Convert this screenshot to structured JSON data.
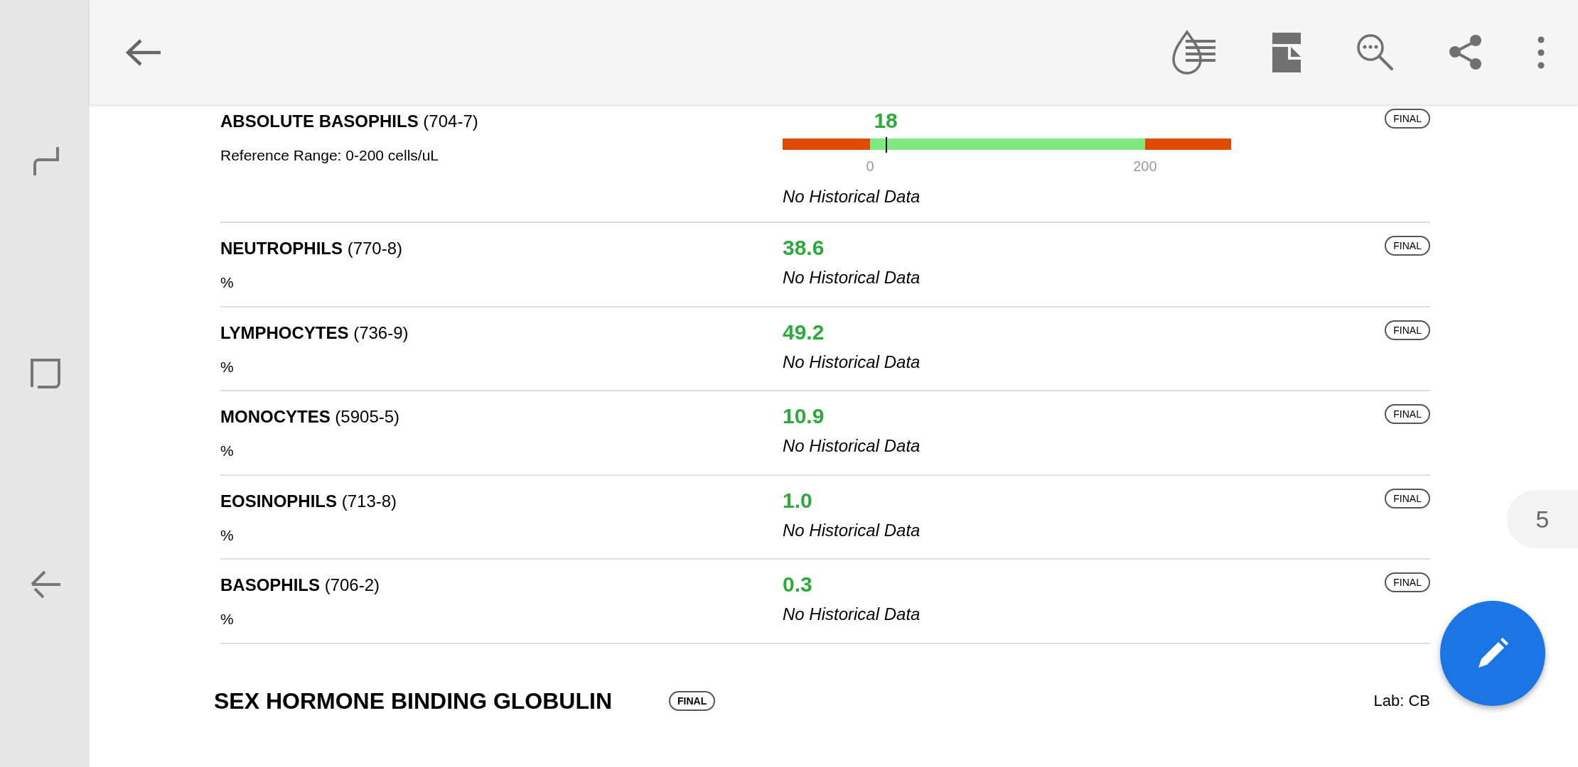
{
  "page_indicator": "5",
  "results": [
    {
      "kind": "range",
      "name": "ABSOLUTE BASOPHILS",
      "code": "(704-7)",
      "detail": "Reference Range: 0-200 cells/uL",
      "value": "18",
      "level": 0.23,
      "ticks": [
        "0",
        "200"
      ],
      "history": "No Historical Data",
      "status": "FINAL"
    },
    {
      "kind": "plain",
      "name": "NEUTROPHILS",
      "code": "(770-8)",
      "detail": "%",
      "value": "38.6",
      "history": "No Historical Data",
      "status": "FINAL"
    },
    {
      "kind": "plain",
      "name": "LYMPHOCYTES",
      "code": "(736-9)",
      "detail": "%",
      "value": "49.2",
      "history": "No Historical Data",
      "status": "FINAL"
    },
    {
      "kind": "plain",
      "name": "MONOCYTES",
      "code": "(5905-5)",
      "detail": "%",
      "value": "10.9",
      "history": "No Historical Data",
      "status": "FINAL"
    },
    {
      "kind": "plain",
      "name": "EOSINOPHILS",
      "code": "(713-8)",
      "detail": "%",
      "value": "1.0",
      "history": "No Historical Data",
      "status": "FINAL"
    },
    {
      "kind": "plain",
      "name": "BASOPHILS",
      "code": "(706-2)",
      "detail": "%",
      "value": "0.3",
      "history": "No Historical Data",
      "status": "FINAL"
    }
  ],
  "section": {
    "title": "SEX HORMONE BINDING GLOBULIN",
    "status": "FINAL",
    "lab": "Lab: CB"
  }
}
